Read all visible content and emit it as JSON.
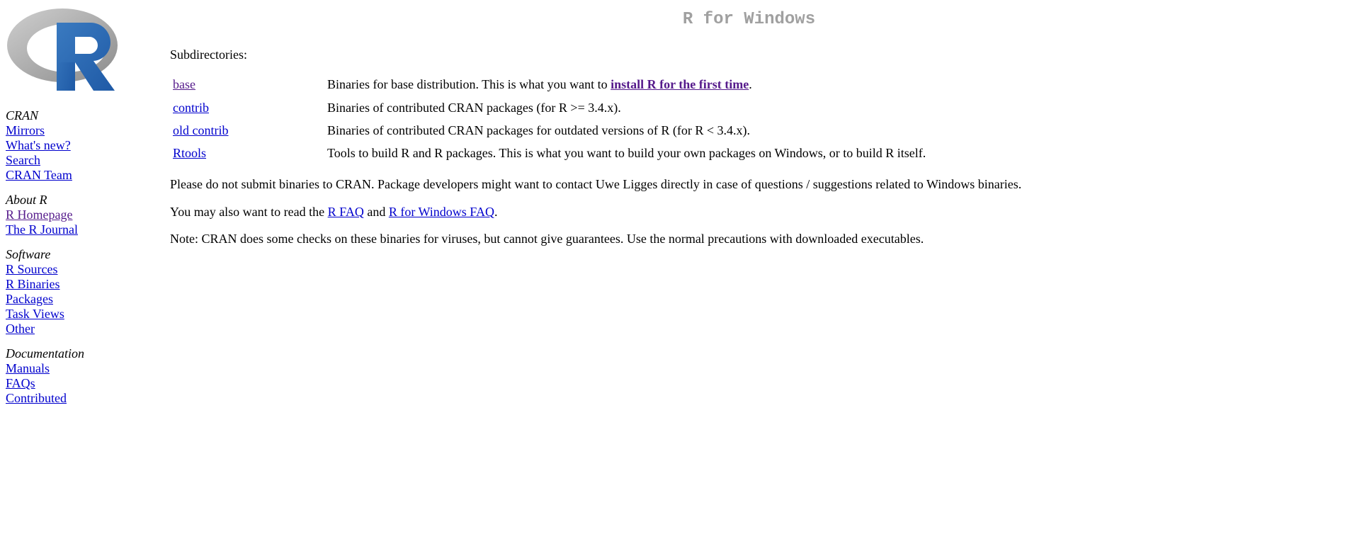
{
  "sidebar": {
    "sections": [
      {
        "heading": "CRAN",
        "items": [
          {
            "label": "Mirrors",
            "visited": false
          },
          {
            "label": "What's new?",
            "visited": false
          },
          {
            "label": "Search",
            "visited": false
          },
          {
            "label": "CRAN Team",
            "visited": false
          }
        ]
      },
      {
        "heading": "About R",
        "items": [
          {
            "label": "R Homepage",
            "visited": true
          },
          {
            "label": "The R Journal",
            "visited": false
          }
        ]
      },
      {
        "heading": "Software",
        "items": [
          {
            "label": "R Sources",
            "visited": false
          },
          {
            "label": "R Binaries",
            "visited": false
          },
          {
            "label": "Packages",
            "visited": false
          },
          {
            "label": "Task Views",
            "visited": false
          },
          {
            "label": "Other",
            "visited": false
          }
        ]
      },
      {
        "heading": "Documentation",
        "items": [
          {
            "label": "Manuals",
            "visited": false
          },
          {
            "label": "FAQs",
            "visited": false
          },
          {
            "label": "Contributed",
            "visited": false
          }
        ]
      }
    ]
  },
  "main": {
    "title": "R for Windows",
    "subdirs_label": "Subdirectories:",
    "rows": [
      {
        "link": "base",
        "visited": true,
        "desc_pre": "Binaries for base distribution. This is what you want to ",
        "install_link": "install R for the first time",
        "desc_post": "."
      },
      {
        "link": "contrib",
        "visited": false,
        "desc": "Binaries of contributed CRAN packages (for R >= 3.4.x)."
      },
      {
        "link": "old contrib",
        "visited": false,
        "desc": "Binaries of contributed CRAN packages for outdated versions of R (for R < 3.4.x)."
      },
      {
        "link": "Rtools",
        "visited": false,
        "desc": "Tools to build R and R packages. This is what you want to build your own packages on Windows, or to build R itself."
      }
    ],
    "para_submit": "Please do not submit binaries to CRAN. Package developers might want to contact Uwe Ligges directly in case of questions / suggestions related to Windows binaries.",
    "faq_pre": "You may also want to read the ",
    "faq_link1": "R FAQ",
    "faq_mid": " and ",
    "faq_link2": "R for Windows FAQ",
    "faq_post": ".",
    "para_note": "Note: CRAN does some checks on these binaries for viruses, but cannot give guarantees. Use the normal precautions with downloaded executables."
  }
}
